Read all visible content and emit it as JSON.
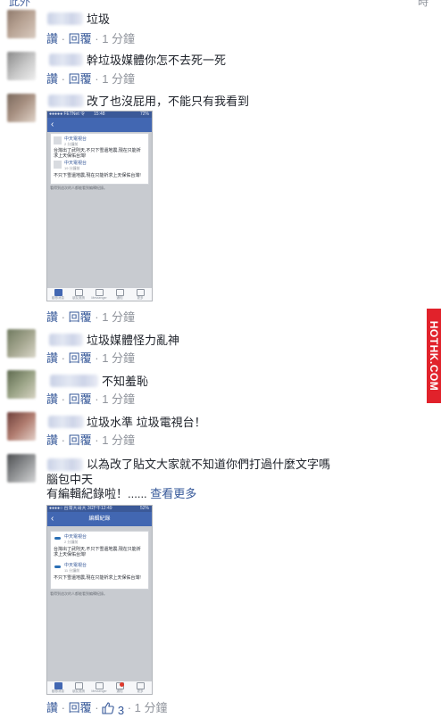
{
  "top_partial": {
    "left_text": "此外",
    "right_text": "時"
  },
  "labels": {
    "like": "讚",
    "reply": "回覆",
    "dot": "·"
  },
  "comments": [
    {
      "text": "垃圾",
      "time": "1 分鐘"
    },
    {
      "text": "幹垃圾媒體你怎不去死一死",
      "time": "1 分鐘"
    },
    {
      "text": "改了也沒屁用，不能只有我看到",
      "time": "1 分鐘"
    },
    {
      "text": "垃圾媒體怪力亂神",
      "time": "1 分鐘"
    },
    {
      "text": "不知羞恥",
      "time": "1 分鐘"
    },
    {
      "text": "垃圾水準 垃圾電視台！",
      "time": "1 分鐘"
    },
    {
      "text_line1": "以為改了貼文大家就不知道你們打過什麼文字嗎",
      "text_line2": "腦包中天",
      "text_line3": "有編輯紀錄啦！......",
      "see_more": "查看更多",
      "reaction_count": "3",
      "time": "1 分鐘"
    }
  ],
  "embedded_screenshot_1": {
    "status_left": "●●●●● FETNet 令",
    "status_center": "15:48",
    "status_right": "72%",
    "posts": [
      {
        "page_name": "中天電視台",
        "meta": "2 分鐘前",
        "body": "台灣出了武則天,不只下雪還地震,現在只能祈求上天保佑台灣!"
      },
      {
        "page_name": "中天電視台",
        "meta": "19 分鐘前",
        "body": "不只下雪還地震,現在只能祈求上天保佑台灣!"
      }
    ],
    "note": "看得到這次的人都能看到編輯紀錄。",
    "tabs": [
      "動態消息",
      "朋友邀請",
      "Messenger",
      "通知",
      "更多"
    ]
  },
  "embedded_screenshot_2": {
    "status_left": "●●●●○ 台灣大哥大 3G",
    "status_center": "下午12:49",
    "status_right": "52%",
    "header_title": "編輯紀錄",
    "posts": [
      {
        "page_name": "中天電視台",
        "meta": "2 分鐘前",
        "body": "台灣出了武則天,不只下雪還地震,現在只能祈求上天保佑台灣!"
      },
      {
        "page_name": "中天電視台",
        "meta": "11 分鐘前",
        "body": "不只下雪還地震,現在只能祈求上天保佑台灣!"
      }
    ],
    "note": "看得到這次的人都能看到編輯紀錄。",
    "tabs": [
      "動態消息",
      "朋友邀請",
      "Messenger",
      "通知",
      "更多"
    ]
  },
  "watermark": {
    "text": "HOTHK.COM",
    "color": "#e1222b"
  },
  "colors": {
    "link": "#365899",
    "muted": "#90949c",
    "text": "#1d2129",
    "fb_blue": "#4267b2"
  },
  "icons": {
    "reaction": "thumbs-up-icon"
  }
}
